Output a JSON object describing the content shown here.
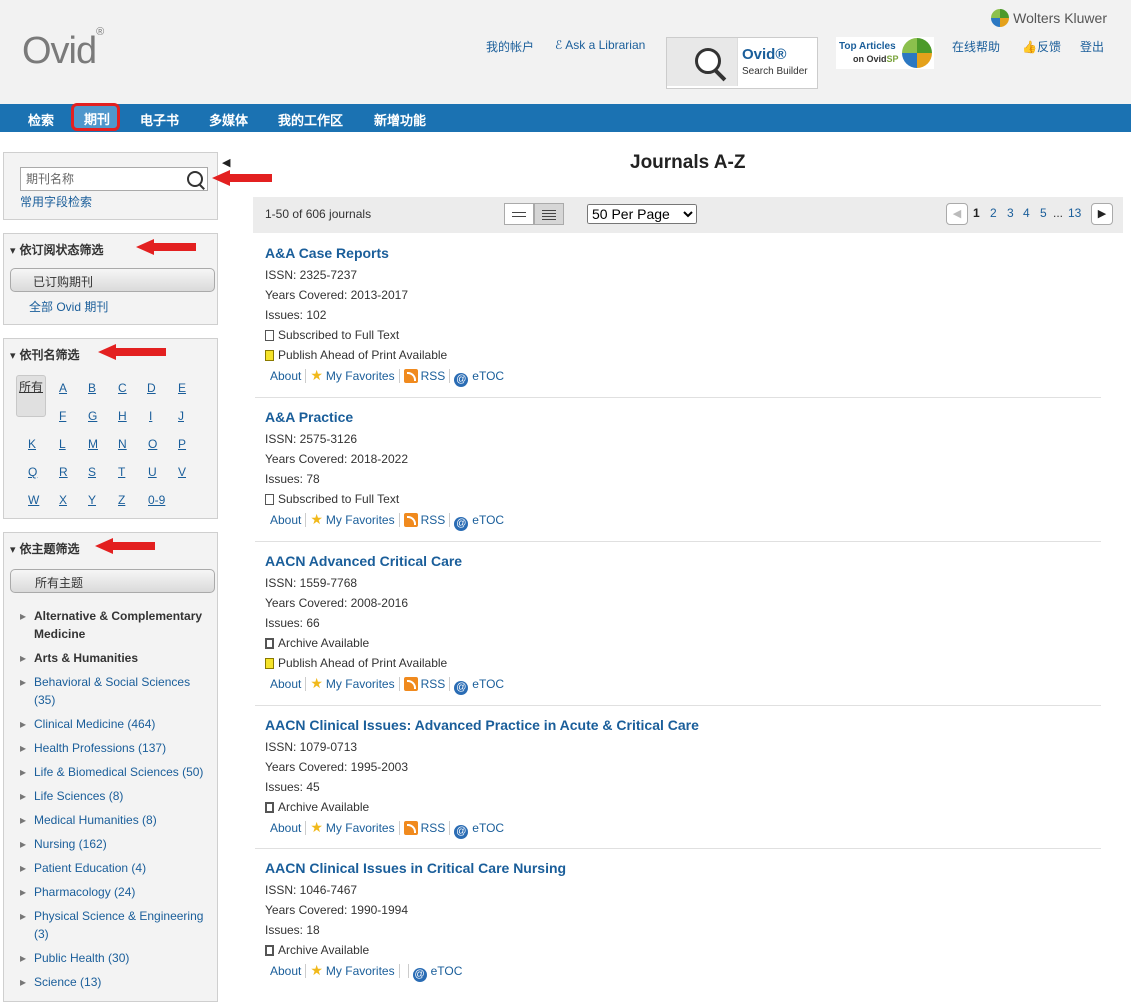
{
  "header": {
    "logo": "Ovid",
    "logo_mark": "®",
    "brand": "Wolters Kluwer",
    "my_account": "我的帐户",
    "ask_librarian": "Ask a Librarian",
    "search_builder_title": "Ovid®",
    "search_builder_sub": "Search Builder",
    "top_articles_1": "Top Articles",
    "top_articles_2": "on Ovid",
    "top_articles_sp": "SP",
    "help": "在线帮助",
    "feedback": "反馈",
    "logout": "登出"
  },
  "nav": {
    "items": [
      "检索",
      "期刊",
      "电子书",
      "多媒体",
      "我的工作区",
      "新增功能"
    ],
    "active": "期刊"
  },
  "sidebar": {
    "search": {
      "placeholder": "期刊名称",
      "field_search_link": "常用字段检索"
    },
    "subscription": {
      "heading": "依订阅状态筛选",
      "selected": "已订购期刊",
      "all_link": "全部 Ovid 期刊"
    },
    "by_title": {
      "heading": "依刊名筛选",
      "all_label": "所有",
      "letters": [
        "A",
        "B",
        "C",
        "D",
        "E",
        "F",
        "G",
        "H",
        "I",
        "J",
        "K",
        "L",
        "M",
        "N",
        "O",
        "P",
        "Q",
        "R",
        "S",
        "T",
        "U",
        "V",
        "W",
        "X",
        "Y",
        "Z",
        "0-9"
      ]
    },
    "by_subject": {
      "heading": "依主题筛选",
      "selected": "所有主题",
      "items": [
        "Alternative & Complementary Medicine",
        "Arts & Humanities",
        "Behavioral & Social Sciences (35)",
        "Clinical Medicine (464)",
        "Health Professions (137)",
        "Life & Biomedical Sciences (50)",
        "Life Sciences (8)",
        "Medical Humanities (8)",
        "Nursing (162)",
        "Patient Education (4)",
        "Pharmacology (24)",
        "Physical Science & Engineering (3)",
        "Public Health (30)",
        "Science (13)"
      ]
    }
  },
  "main": {
    "title": "Journals A-Z",
    "count": "1-50 of 606 journals",
    "per_page": "50   Per Page",
    "pages": [
      "1",
      "2",
      "3",
      "4",
      "5",
      "...",
      "13"
    ],
    "current_page": "1",
    "action_labels": {
      "about": "About",
      "favorites": "My Favorites",
      "rss": "RSS",
      "etoc": "eTOC"
    },
    "journals": [
      {
        "title": "A&A Case Reports",
        "issn": "ISSN: 2325-7237",
        "years": "Years Covered: 2013-2017",
        "issues": "Issues: 102",
        "flags": [
          "Subscribed to Full Text",
          "Publish Ahead of Print Available"
        ]
      },
      {
        "title": "A&A Practice",
        "issn": "ISSN: 2575-3126",
        "years": "Years Covered: 2018-2022",
        "issues": "Issues: 78",
        "flags": [
          "Subscribed to Full Text"
        ]
      },
      {
        "title": "AACN Advanced Critical Care",
        "issn": "ISSN: 1559-7768",
        "years": "Years Covered: 2008-2016",
        "issues": "Issues: 66",
        "flags": [
          "Archive Available",
          "Publish Ahead of Print Available"
        ]
      },
      {
        "title": "AACN Clinical Issues: Advanced Practice in Acute & Critical Care",
        "issn": "ISSN: 1079-0713",
        "years": "Years Covered: 1995-2003",
        "issues": "Issues: 45",
        "flags": [
          "Archive Available"
        ]
      },
      {
        "title": "AACN Clinical Issues in Critical Care Nursing",
        "issn": "ISSN: 1046-7467",
        "years": "Years Covered: 1990-1994",
        "issues": "Issues: 18",
        "flags": [
          "Archive Available"
        ]
      }
    ]
  },
  "colors": {
    "nav_bg": "#1b72b2",
    "link": "#1a5e9a",
    "highlight_red": "#e32020",
    "header_bg": "#f2f2f2"
  }
}
